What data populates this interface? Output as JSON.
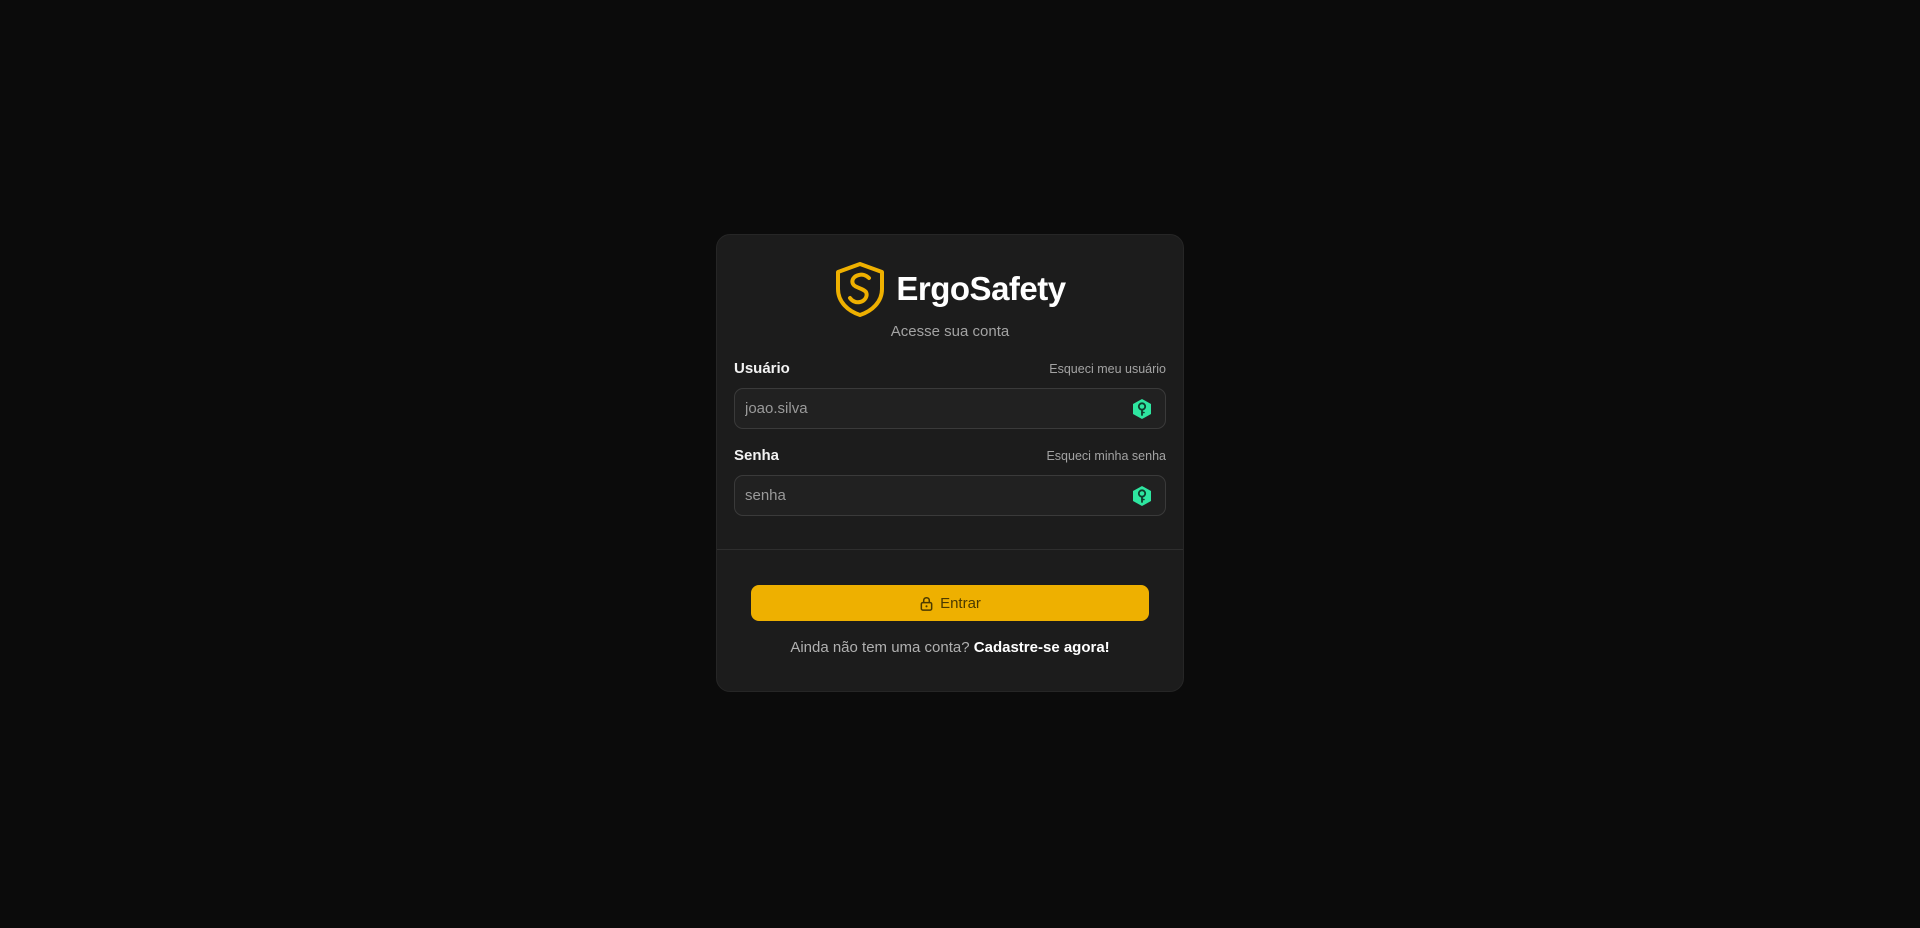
{
  "brand": {
    "name": "ErgoSafety",
    "accent_color": "#eeb000",
    "logo_icon": "shield-s-icon"
  },
  "subtitle": "Acesse sua conta",
  "username": {
    "label": "Usuário",
    "forgot_link": "Esqueci meu usuário",
    "value": "",
    "placeholder": "joao.silva",
    "icon": "key-icon"
  },
  "password": {
    "label": "Senha",
    "forgot_link": "Esqueci minha senha",
    "value": "",
    "placeholder": "senha",
    "icon": "key-icon"
  },
  "submit": {
    "label": "Entrar",
    "icon": "lock-icon"
  },
  "signup": {
    "prompt": "Ainda não tem uma conta?",
    "link": "Cadastre-se agora!"
  },
  "colors": {
    "background": "#0b0b0b",
    "card": "#1c1c1c",
    "key_icon": "#2ee6a0"
  }
}
